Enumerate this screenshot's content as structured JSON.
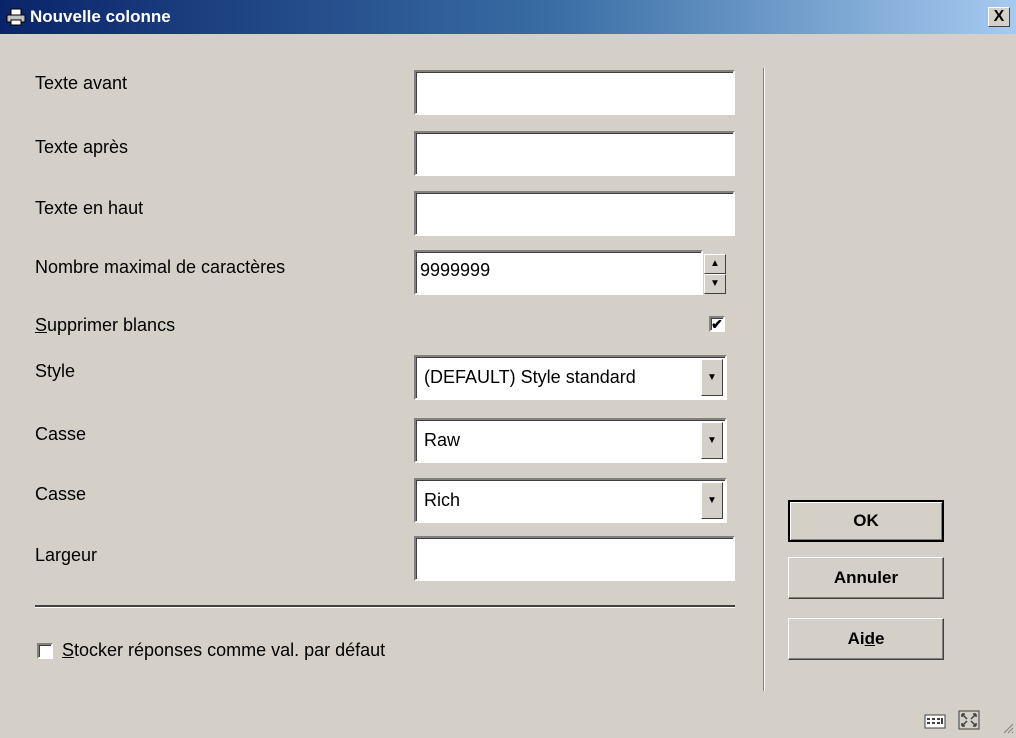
{
  "window": {
    "title": "Nouvelle colonne",
    "close_label": "X"
  },
  "form": {
    "texte_avant": {
      "label": "Texte avant",
      "value": ""
    },
    "texte_apres": {
      "label": "Texte après",
      "value": ""
    },
    "texte_haut": {
      "label": "Texte en haut",
      "value": ""
    },
    "max_chars": {
      "label": "Nombre maximal de caractères",
      "value": "9999999"
    },
    "supprimer": {
      "label_u": "S",
      "label_rest": "upprimer blancs",
      "checked": true,
      "mark": "✔"
    },
    "style": {
      "label": "Style",
      "value": "(DEFAULT) Style standard"
    },
    "casse1": {
      "label": "Casse",
      "value": "Raw"
    },
    "casse2": {
      "label": "Casse",
      "value": "Rich"
    },
    "largeur": {
      "label": "Largeur",
      "value": ""
    },
    "stocker": {
      "label_u": "S",
      "label_rest": "tocker réponses comme val. par défaut",
      "checked": false
    }
  },
  "buttons": {
    "ok": "OK",
    "annuler": "Annuler",
    "aide_pre": "Ai",
    "aide_u": "d",
    "aide_post": "e"
  },
  "icons": {
    "title": "printer-icon",
    "arrow_up": "▲",
    "arrow_down": "▼"
  }
}
